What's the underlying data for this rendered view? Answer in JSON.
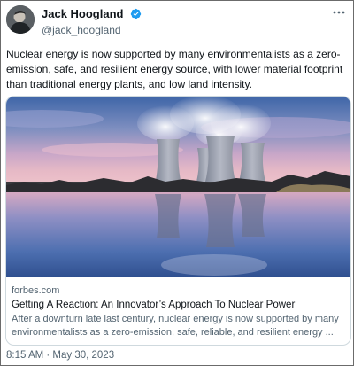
{
  "author": {
    "display_name": "Jack Hoogland",
    "handle": "@jack_hoogland",
    "verified": true,
    "avatar_icon": "person-avatar"
  },
  "tweet": {
    "text": "Nuclear energy is now supported by many environmentalists as a zero-emission, safe, and resilient energy source, with lower material footprint than traditional energy plants, and low land intensity.",
    "timestamp": "8:15 AM · May 30, 2023"
  },
  "card": {
    "domain": "forbes.com",
    "title": "Getting A Reaction: An Innovator’s Approach To Nuclear Power",
    "description": "After a downturn late last century, nuclear energy is now supported by many environmentalists as a zero-emission, safe, reliable, and resilient energy ...",
    "image_icon": "nuclear-cooling-towers-photo"
  },
  "colors": {
    "text": "#0f1419",
    "secondary": "#536471",
    "verified": "#1d9bf0",
    "border": "#cfd9de"
  },
  "icons": {
    "more": "more-horizontal-icon",
    "verified": "verified-badge-icon"
  }
}
